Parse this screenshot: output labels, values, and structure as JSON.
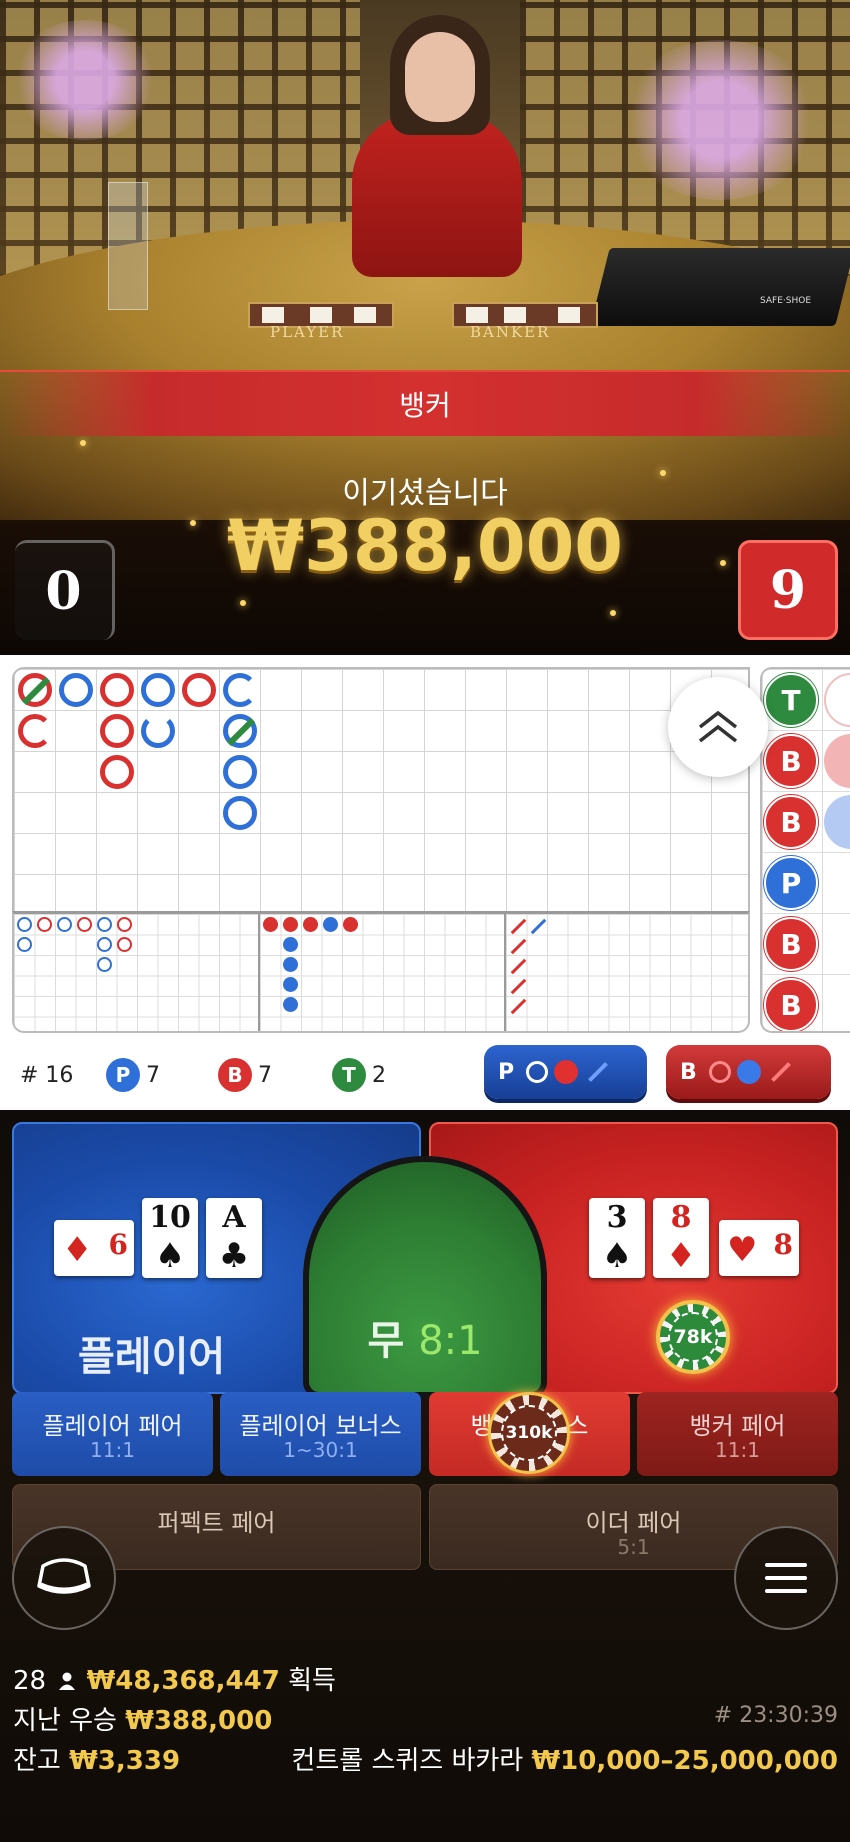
{
  "video": {
    "table_player_label": "PLAYER",
    "table_banker_label": "BANKER",
    "shoe_logo": "SAFE·SHOE",
    "result_label": "뱅커",
    "win_label": "이기셨습니다",
    "win_amount": "₩388,000",
    "player_score": "0",
    "banker_score": "9"
  },
  "roadmap": {
    "bead_road": [
      "T",
      "B",
      "B",
      "P",
      "B",
      "B"
    ],
    "collapse_icon": "double-chevron-up-icon"
  },
  "stats": {
    "round": "# 16",
    "player_badge": "P",
    "player_count": "7",
    "banker_badge": "B",
    "banker_count": "7",
    "tie_badge": "T",
    "tie_count": "2",
    "player_predict": "P",
    "banker_predict": "B"
  },
  "bets": {
    "player_label": "플레이어",
    "tie_label": "무",
    "tie_odds": "8:1",
    "player_cards": [
      {
        "rank": "6",
        "suit": "♦",
        "orientation": "side"
      },
      {
        "rank": "10",
        "suit": "♠"
      },
      {
        "rank": "A",
        "suit": "♣"
      }
    ],
    "banker_cards": [
      {
        "rank": "3",
        "suit": "♠"
      },
      {
        "rank": "8",
        "suit": "♦"
      },
      {
        "rank": "8",
        "suit": "♥",
        "orientation": "side"
      }
    ],
    "banker_chip": "78k",
    "side_bets": [
      {
        "name": "플레이어 페어",
        "odds": "11:1"
      },
      {
        "name": "플레이어 보너스",
        "odds": "1~30:1"
      },
      {
        "name": "뱅커 보너스",
        "odds": ""
      },
      {
        "name": "뱅커 페어",
        "odds": "11:1"
      }
    ],
    "side_chip": "310k",
    "perfect_pair": {
      "name": "퍼펙트 페어",
      "odds": ""
    },
    "either_pair": {
      "name": "이더 페어",
      "odds": "5:1"
    }
  },
  "buttons": {
    "lobby_icon": "lobby-chair-icon",
    "menu_icon": "hamburger-menu-icon"
  },
  "footer": {
    "players": "28",
    "total_won": "₩48,368,447",
    "won_suffix": "획득",
    "last_win_label": "지난 우승",
    "last_win": "₩388,000",
    "round_id": "# 23:30:39",
    "balance_label": "잔고",
    "balance": "₩3,339",
    "game_name": "컨트롤 스퀴즈 바카라",
    "limits": "₩10,000–25,000,000"
  },
  "colors": {
    "banker": "#d93030",
    "player": "#2f6fd8",
    "tie": "#2e8a3e",
    "gold": "#f2c94c"
  }
}
